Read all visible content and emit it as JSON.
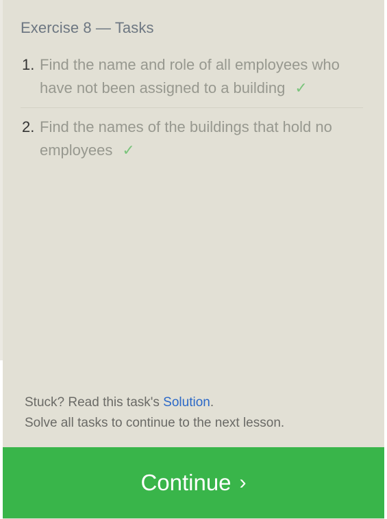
{
  "header": {
    "title": "Exercise 8 — Tasks"
  },
  "tasks": [
    {
      "number": "1.",
      "text": "Find the name and role of all employees who have not been assigned to a building",
      "check": "✓",
      "completed": true
    },
    {
      "number": "2.",
      "text": "Find the names of the buildings that hold no employees",
      "check": "✓",
      "completed": true
    }
  ],
  "footer": {
    "stuck_prefix": "Stuck? Read this task's ",
    "solution_link": "Solution",
    "stuck_suffix": ".",
    "instruction": "Solve all tasks to continue to the next lesson."
  },
  "continue_button": {
    "label": "Continue",
    "chevron": "›"
  },
  "colors": {
    "panel_bg": "#e2e0d5",
    "continue_bg": "#39b54a",
    "check": "#7bc47c",
    "link": "#2b68c7"
  }
}
